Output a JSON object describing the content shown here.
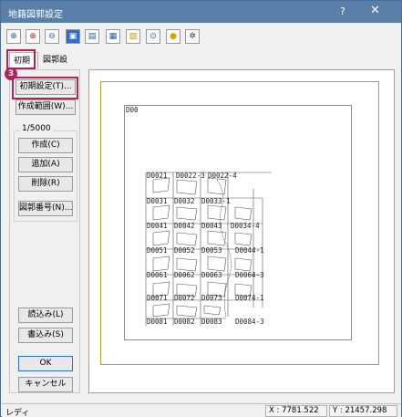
{
  "window": {
    "title": "地籍図郭設定",
    "help": "?",
    "close": "✕"
  },
  "toolbar": {
    "icons": [
      "zoom-in",
      "zoom-in-red",
      "zoom-out",
      "view-blue",
      "page",
      "grid",
      "page-yellow",
      "zoom-find",
      "bulb",
      "gear"
    ]
  },
  "tabs": [
    {
      "label": "初期"
    },
    {
      "label": "図郭設定"
    }
  ],
  "badge": "3",
  "buttons": {
    "initial": "初期設定(T)...",
    "create_range": "作成範囲(W)...",
    "create": "作成(C)",
    "add": "追加(A)",
    "delete": "削除(R)",
    "number": "図郭番号(N)...",
    "load": "読込み(L)",
    "save": "書込み(S)",
    "ok": "OK",
    "cancel": "キャンセル"
  },
  "scale": "1/5000",
  "map": {
    "frame_label": "D00",
    "labels": [
      "D0021",
      "D0022-3",
      "D0022-4",
      "D0031",
      "D0032",
      "D0033-1",
      "D0041",
      "D0042",
      "D0043",
      "D0044-1",
      "D0051",
      "D0052",
      "D0053",
      "D0054-1",
      "D0061",
      "D0062",
      "D0063",
      "D0064-3",
      "D0071",
      "D0072",
      "D0073",
      "D0074-1",
      "D0081",
      "D0082",
      "D0083",
      "D0084-3",
      "D0044-2",
      "D0034-4"
    ]
  },
  "status": {
    "mode": "レディ",
    "x": "X : 7781.522",
    "y": "Y : 21457.298"
  }
}
